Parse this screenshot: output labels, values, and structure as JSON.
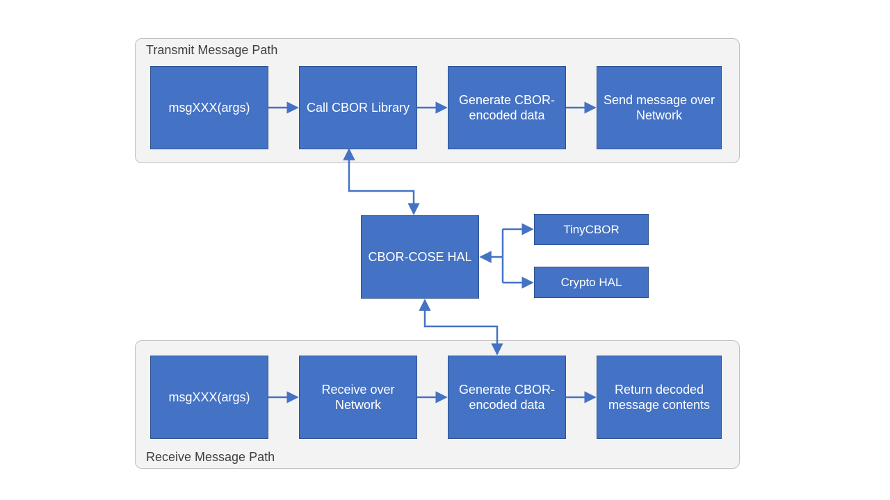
{
  "colors": {
    "block_fill": "#4472C4",
    "block_border": "#2F528F",
    "group_fill": "#F2F2F2",
    "group_border": "#BFBFBF",
    "arrow": "#4472C4"
  },
  "groups": {
    "transmit": {
      "title": "Transmit Message Path"
    },
    "receive": {
      "title": "Receive Message Path"
    }
  },
  "blocks": {
    "tx_msg": "msgXXX(args)",
    "tx_lib": "Call CBOR Library",
    "tx_gen": "Generate CBOR-encoded data",
    "tx_send": "Send message over Network",
    "hal": "CBOR-COSE HAL",
    "tinycbor": "TinyCBOR",
    "cryptohal": "Crypto HAL",
    "rx_msg": "msgXXX(args)",
    "rx_recv": "Receive over Network",
    "rx_gen": "Generate CBOR-encoded data",
    "rx_return": "Return decoded message contents"
  }
}
